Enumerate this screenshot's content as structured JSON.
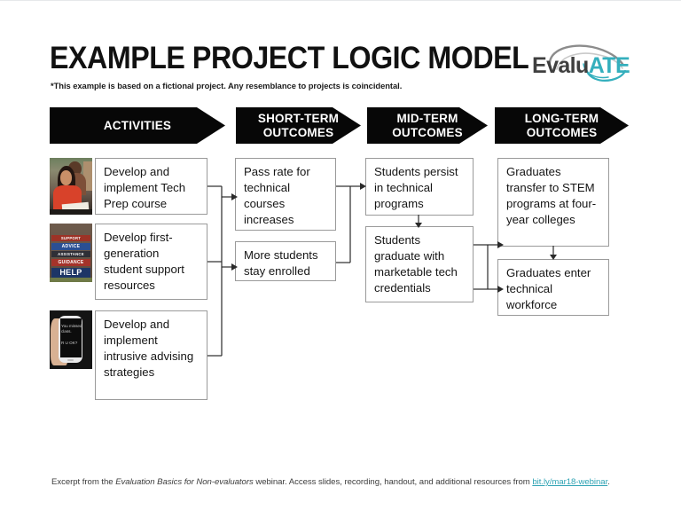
{
  "title": "EXAMPLE PROJECT LOGIC MODEL",
  "subtitle": "*This example is based on a fictional project. Any resemblance to projects is coincidental.",
  "logo": {
    "name": "evaluate-logo",
    "text_dark": "Evalu",
    "text_teal": "ATE",
    "teal_hex": "#34afbd",
    "dark_hex": "#3f3f3f"
  },
  "colors": {
    "header_band": "#070707",
    "header_text": "#ffffff",
    "box_border": "#9a9a9a",
    "box_fill": "#ffffff",
    "link": "#2fa3b4",
    "page_background": "#ffffff"
  },
  "columns": [
    {
      "id": "activities",
      "label_line1": "ACTIVITIES",
      "label_line2": ""
    },
    {
      "id": "short-term-outcomes",
      "label_line1": "SHORT-TERM",
      "label_line2": "OUTCOMES"
    },
    {
      "id": "mid-term-outcomes",
      "label_line1": "MID-TERM",
      "label_line2": "OUTCOMES"
    },
    {
      "id": "long-term-outcomes",
      "label_line1": "LONG-TERM",
      "label_line2": "OUTCOMES"
    }
  ],
  "activities": [
    {
      "text": "Develop and implement Tech Prep course",
      "image": {
        "name": "photo-students-studying",
        "alt": "Two students studying at a classroom desk"
      }
    },
    {
      "text": "Develop first-generation student support resources",
      "image": {
        "name": "photo-help-signs",
        "alt": "Stacked signs reading Support, Advice, Assistance, Guidance, Help",
        "sign_labels": [
          "SUPPORT",
          "ADVICE",
          "ASSISTANCE",
          "GUIDANCE",
          "HELP"
        ]
      }
    },
    {
      "text": "Develop and implement intrusive advising strategies",
      "image": {
        "name": "photo-phone-text-message",
        "alt": "Hand holding a phone showing a text message",
        "message_line1": "You missed class.",
        "message_line2": "R U OK?"
      }
    }
  ],
  "short_term_outcomes": [
    {
      "text": "Pass rate for technical courses increases"
    },
    {
      "text": "More students stay enrolled"
    }
  ],
  "mid_term_outcomes": [
    {
      "text": "Students persist in technical programs"
    },
    {
      "text": "Students graduate with marketable tech credentials"
    }
  ],
  "long_term_outcomes": [
    {
      "text": "Graduates transfer to STEM programs at four-year colleges"
    },
    {
      "text": "Graduates enter technical workforce"
    }
  ],
  "footer": {
    "prefix": "Excerpt from the ",
    "italic": "Evaluation Basics for Non-evaluators",
    "middle": " webinar. Access slides, recording, handout, and additional resources from ",
    "link": "bit.ly/mar18-webinar",
    "suffix": "."
  }
}
